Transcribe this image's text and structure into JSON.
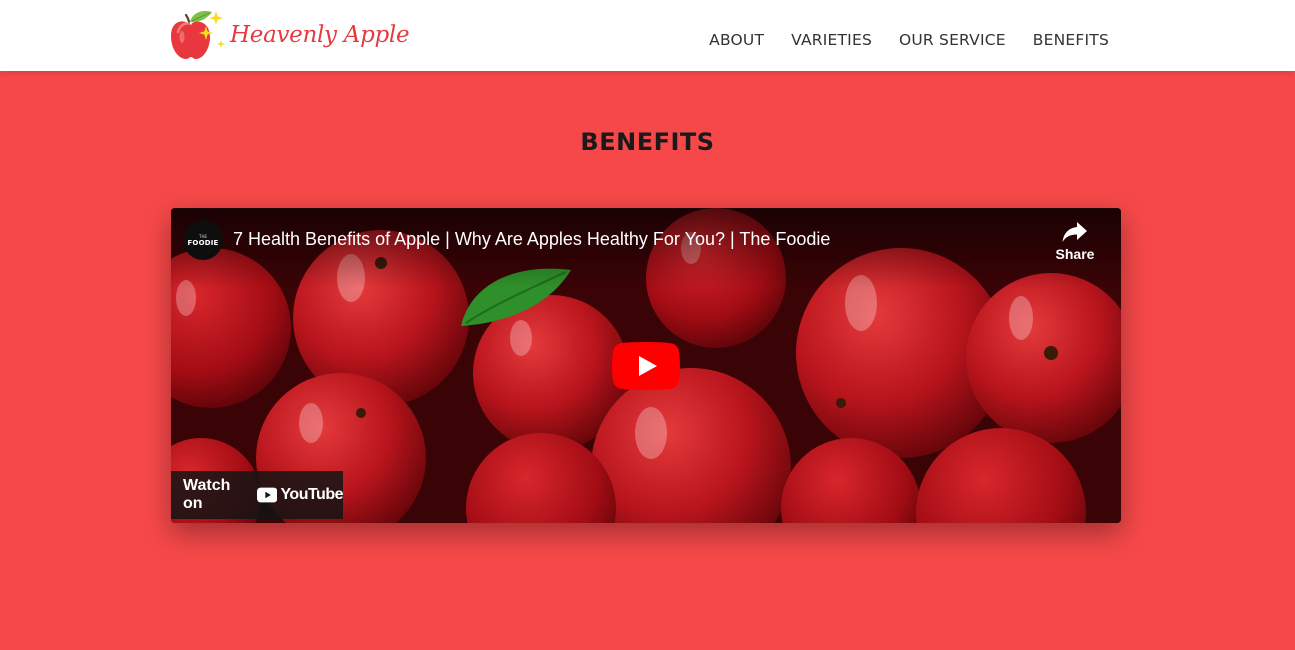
{
  "brand": {
    "name": "Heavenly Apple",
    "logo_icon": "apple-sparkle-icon"
  },
  "nav": {
    "items": [
      "ABOUT",
      "VARIETIES",
      "OUR SERVICE",
      "BENEFITS"
    ]
  },
  "section": {
    "title": "BENEFITS"
  },
  "video": {
    "title": "7 Health Benefits of Apple | Why Are Apples Healthy For You? | The Foodie",
    "channel_avatar_small": "THE",
    "channel_avatar_brand": "FOODIE",
    "share_label": "Share",
    "share_icon": "share-arrow-icon",
    "play_icon": "youtube-play-icon",
    "watch_on_label": "Watch on",
    "youtube_wordmark": "YouTube"
  },
  "colors": {
    "page_background": "#f64849",
    "navbar_background": "#ffffff",
    "brand_text": "#e53a3f",
    "nav_text": "#333333",
    "play_button": "#ff0000"
  }
}
